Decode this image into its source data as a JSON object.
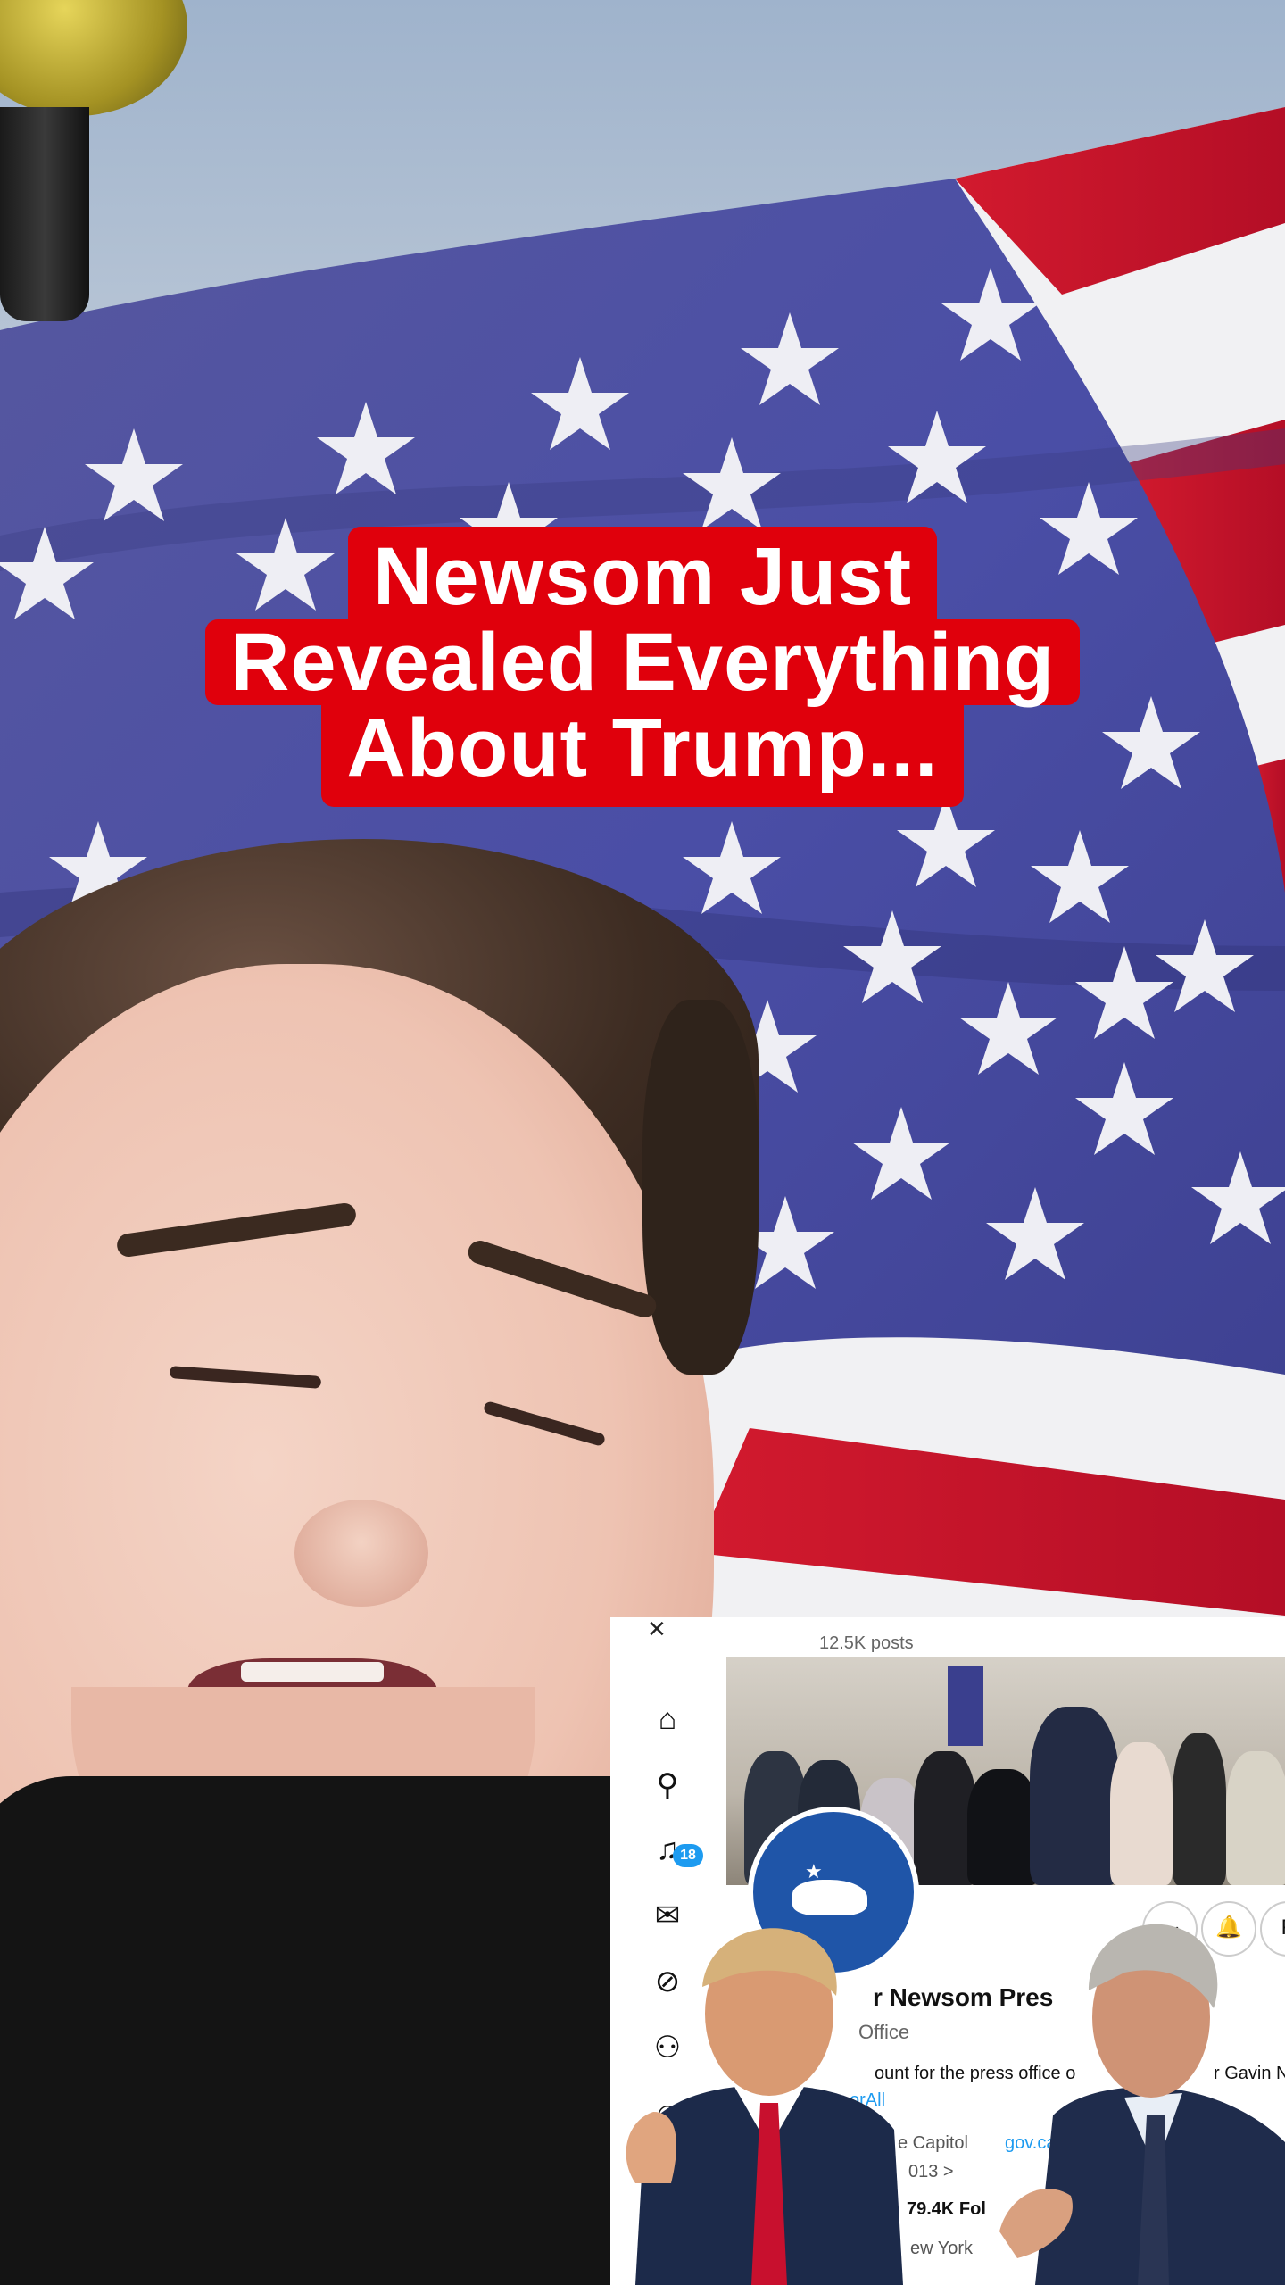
{
  "caption": {
    "line1": "Newsom Just",
    "line2": "Revealed Everything",
    "line3": "About Trump..."
  },
  "inset": {
    "close_icon": "×",
    "post_count": "12.5K posts",
    "profile_name": "r Newsom Pres",
    "profile_sub": "Office",
    "bio_part1": "ount for the press office o",
    "bio_part2": "r Gavin N",
    "bio_tag": "orAll",
    "location": "e Capitol",
    "link": "gov.ca",
    "joined": "013 >",
    "followers": "79.4K Fol",
    "city": "ew York",
    "notification_count": "18",
    "rail_icons": [
      "home-icon",
      "search-icon",
      "bell-icon",
      "mail-icon",
      "grok-icon",
      "communities-icon",
      "profile-icon"
    ],
    "actions": [
      "···",
      "🔔",
      "F"
    ]
  },
  "colors": {
    "caption_bg": "#e0000c",
    "caption_text": "#ffffff",
    "flag_blue": "#4a4ea6",
    "flag_red": "#c8102e",
    "link_blue": "#1d9bf0"
  }
}
